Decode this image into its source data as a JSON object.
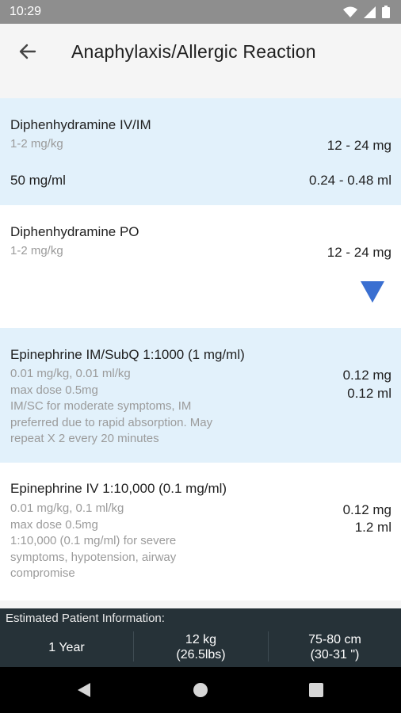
{
  "status_bar": {
    "time": "10:29"
  },
  "app_bar": {
    "title": "Anaphylaxis/Allergic Reaction"
  },
  "drugs": [
    {
      "name": "Diphenhydramine IV/IM",
      "detail": "1-2 mg/kg",
      "dose": "12 - 24 mg",
      "concentration": "50 mg/ml",
      "volume": "0.24 - 0.48 ml",
      "background": "#e2f1fb"
    },
    {
      "name": "Diphenhydramine PO",
      "detail": "1-2 mg/kg",
      "dose": "12 - 24 mg",
      "background": "#ffffff"
    },
    {
      "name": "Epinephrine IM/SubQ 1:1000 (1 mg/ml)",
      "detail": "0.01 mg/kg, 0.01 ml/kg\nmax dose 0.5mg\nIM/SC for moderate symptoms, IM\npreferred due to rapid absorption. May\nrepeat X 2 every 20 minutes",
      "dose": "0.12 mg",
      "volume": "0.12 ml",
      "background": "#e2f1fb"
    },
    {
      "name": "Epinephrine IV 1:10,000 (0.1 mg/ml)",
      "detail": "0.01 mg/kg, 0.1 ml/kg\nmax dose 0.5mg\n1:10,000 (0.1 mg/ml) for severe\nsymptoms, hypotension, airway\ncompromise",
      "dose": "0.12 mg",
      "volume": "1.2 ml",
      "background": "#ffffff"
    }
  ],
  "patient_info": {
    "header": "Estimated Patient Information:",
    "age": "1 Year",
    "weight_kg": "12 kg",
    "weight_lbs": "(26.5lbs)",
    "height_cm": "75-80 cm",
    "height_in": "(30-31 \")"
  },
  "colors": {
    "accent": "#3a6fd1",
    "status_bar": "#8e8e8e",
    "bottom_bar": "#263238",
    "card_blue": "#e2f1fb"
  },
  "icons": [
    "arrow-back-icon",
    "wifi-icon",
    "signal-icon",
    "battery-icon",
    "expand-triangle-icon",
    "nav-back-icon",
    "nav-home-icon",
    "nav-recents-icon"
  ]
}
